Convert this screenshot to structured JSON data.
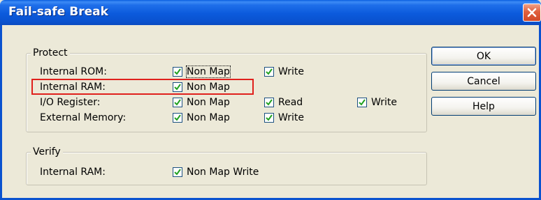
{
  "window": {
    "title": "Fail-safe Break"
  },
  "protect": {
    "legend": "Protect",
    "rows": [
      {
        "label": "Internal ROM:",
        "options": [
          "Non Map",
          "Write"
        ]
      },
      {
        "label": "Internal RAM:",
        "options": [
          "Non Map"
        ]
      },
      {
        "label": "I/O Register:",
        "options": [
          "Non Map",
          "Read",
          "Write"
        ]
      },
      {
        "label": "External Memory:",
        "options": [
          "Non Map",
          "Write"
        ]
      }
    ]
  },
  "verify": {
    "legend": "Verify",
    "row": {
      "label": "Internal RAM:",
      "options": [
        "Non Map Write"
      ]
    }
  },
  "buttons": {
    "ok": "OK",
    "cancel": "Cancel",
    "help": "Help"
  },
  "colors": {
    "title_bar": "#0a5fe0",
    "highlight": "#e0201c",
    "dialog_bg": "#ece9d8"
  }
}
